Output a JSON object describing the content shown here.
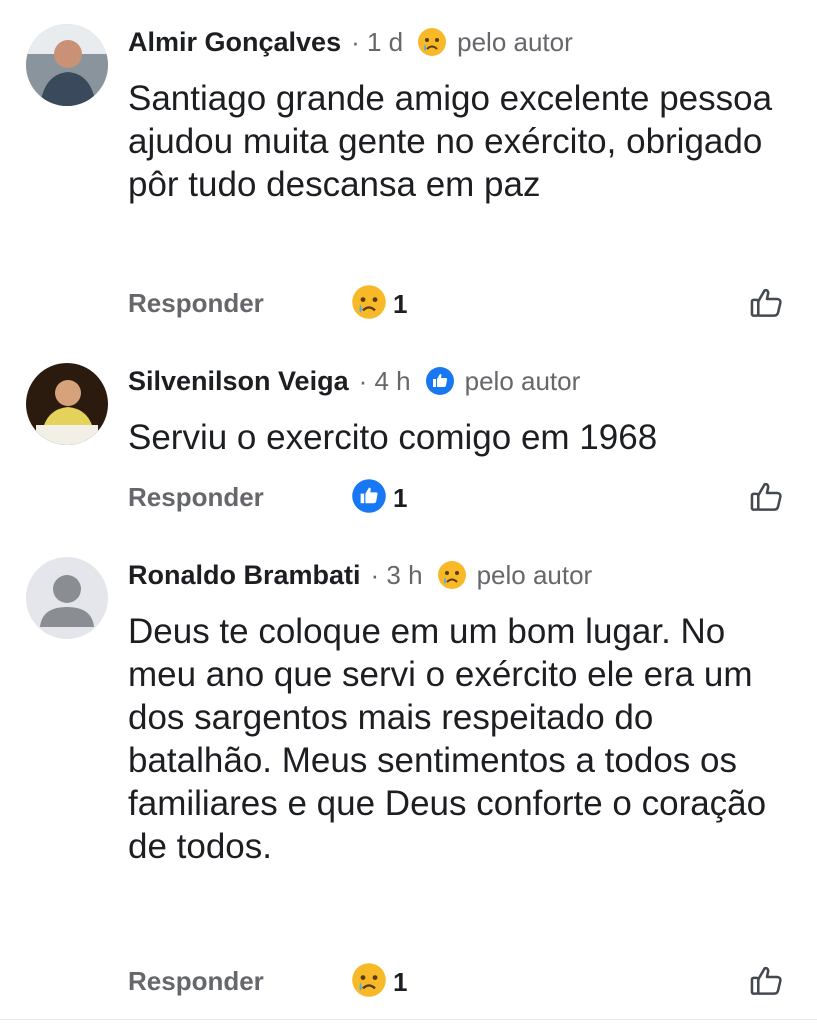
{
  "colors": {
    "text": "#1c1e21",
    "muted": "#65676b",
    "like_blue": "#1877f2",
    "sad_yellow": "#f7b928"
  },
  "comments": [
    {
      "author": "Almir Gonçalves",
      "time": "· 1 d",
      "badge_icon": "sad-emoji-icon",
      "by_author": "pelo autor",
      "text": "Santiago grande amigo excelente pessoa ajudou muita gente no exército, obrigado pôr tudo descansa em paz",
      "reply_label": "Responder",
      "reaction_icon": "sad-emoji-icon",
      "reaction_count": "1"
    },
    {
      "author": "Silvenilson Veiga",
      "time": "· 4 h",
      "badge_icon": "like-icon",
      "by_author": "pelo autor",
      "text": "Serviu o exercito comigo em 1968",
      "reply_label": "Responder",
      "reaction_icon": "like-icon",
      "reaction_count": "1"
    },
    {
      "author": "Ronaldo Brambati",
      "time": "· 3 h",
      "badge_icon": "sad-emoji-icon",
      "by_author": "pelo autor",
      "text": "Deus te coloque em um bom lugar. No meu ano que servi o exército ele era um dos sargentos mais respeitado do batalhão. Meus sentimentos a todos os familiares e que Deus conforte o coração de todos.",
      "reply_label": "Responder",
      "reaction_icon": "sad-emoji-icon",
      "reaction_count": "1"
    }
  ]
}
